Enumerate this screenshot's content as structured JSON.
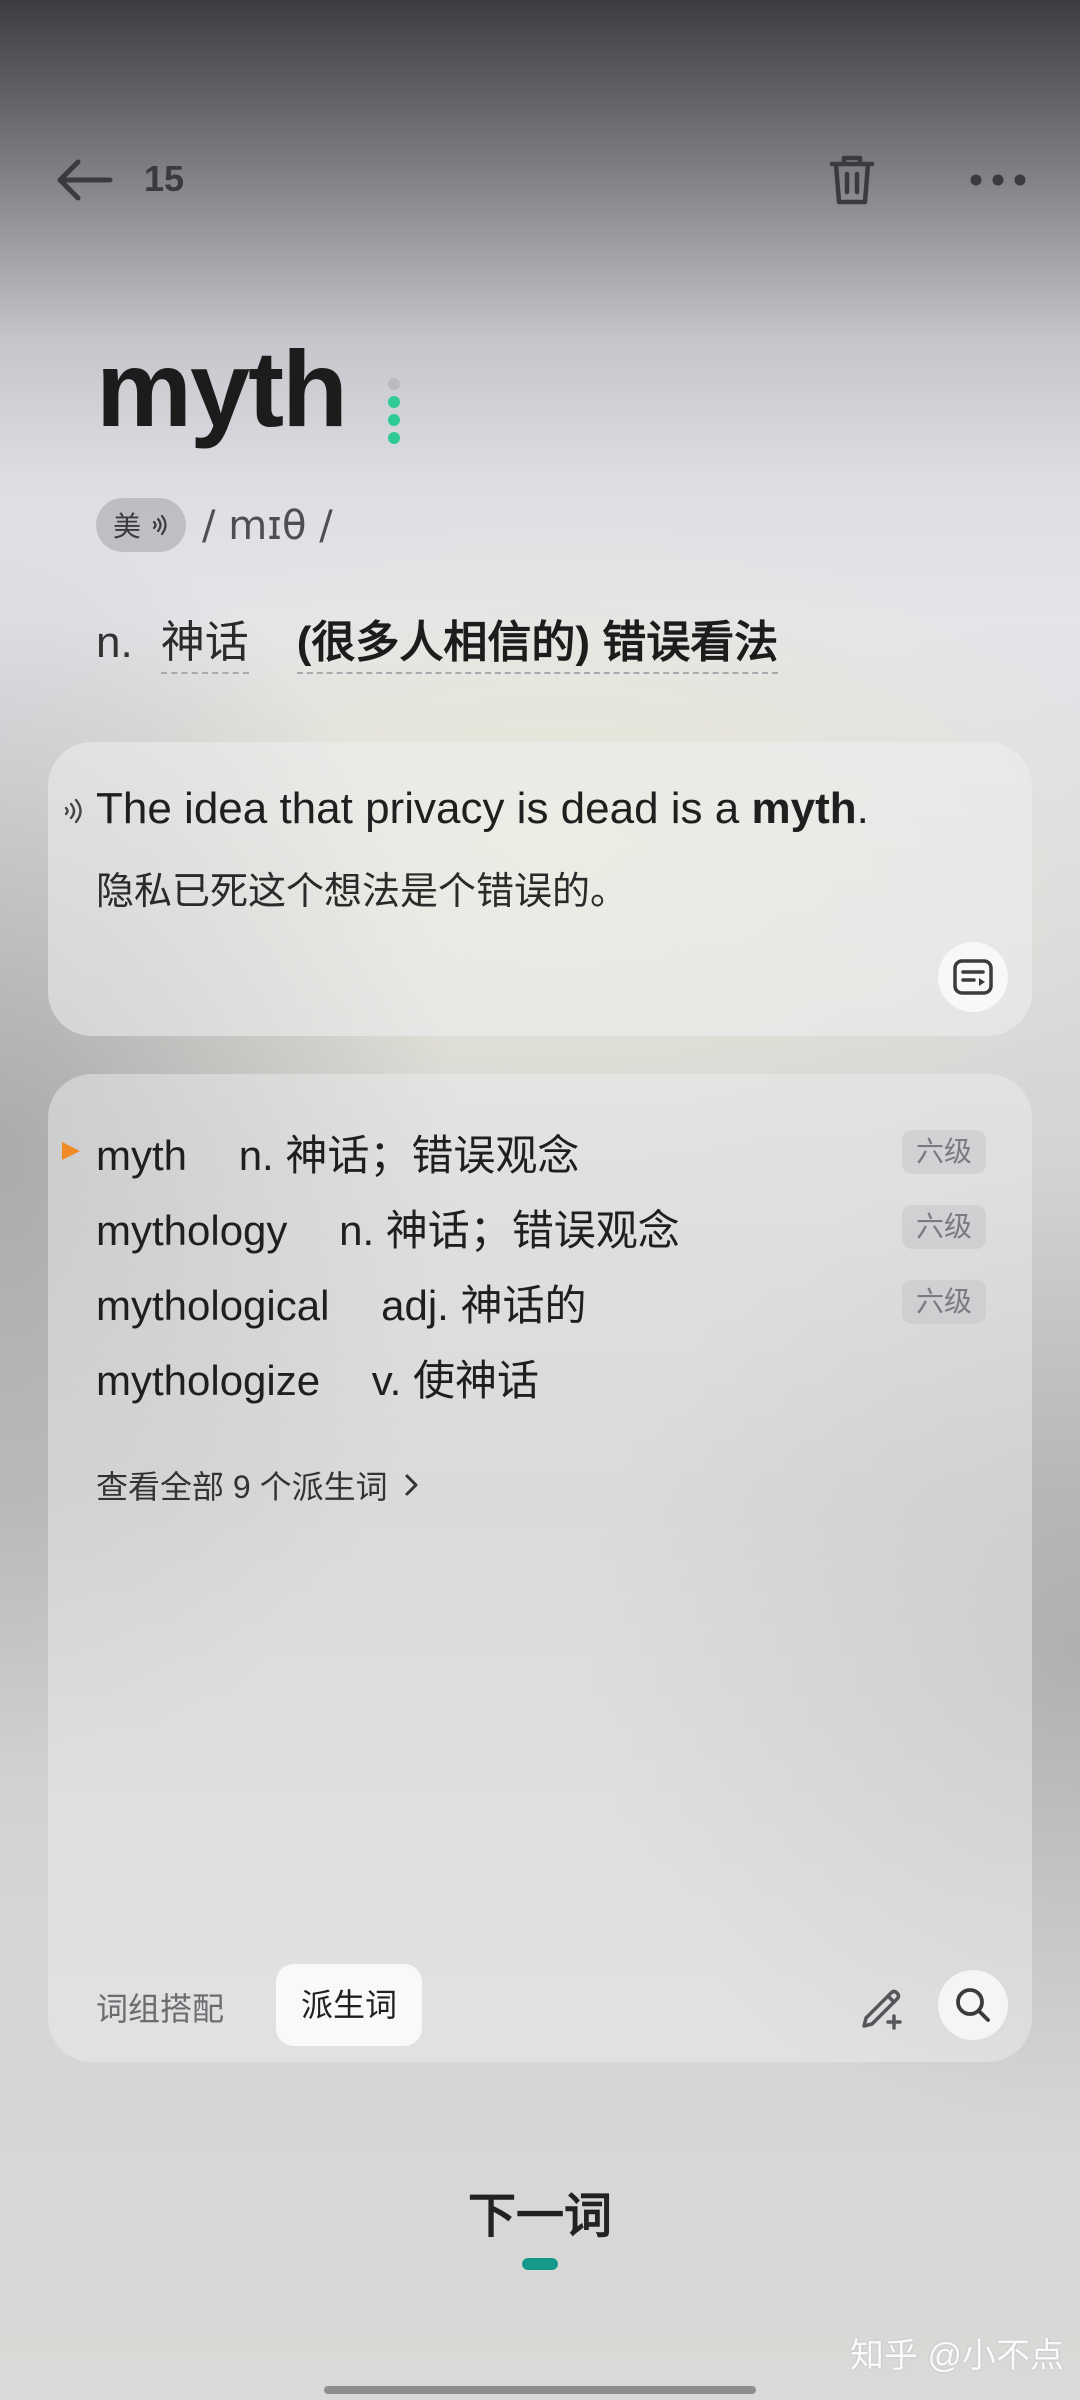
{
  "topbar": {
    "count": "15",
    "back_icon": "arrow-left-icon",
    "trash_icon": "trash-icon",
    "more_icon": "more-horizontal-icon"
  },
  "word": {
    "headword": "myth",
    "level_dot_colors": [
      "#b9bbbe",
      "#2fcb95",
      "#2fcb95",
      "#2fcb95"
    ],
    "pron_label": "美",
    "phonetic": "/ mɪθ /",
    "pos": "n.",
    "senses": [
      "神话",
      "(很多人相信的) 错误看法"
    ]
  },
  "example": {
    "en_before": "The idea that privacy is dead is a ",
    "en_highlight": "myth",
    "en_after": ".",
    "zh": "隐私已死这个想法是个错误的。"
  },
  "derivatives": {
    "items": [
      {
        "word": "myth",
        "meaning": "n. 神话；错误观念",
        "tag": "六级"
      },
      {
        "word": "mythology",
        "meaning": "n. 神话；错误观念",
        "tag": "六级"
      },
      {
        "word": "mythological",
        "meaning": "adj. 神话的",
        "tag": "六级"
      },
      {
        "word": "mythologize",
        "meaning": "v. 使神话",
        "tag": ""
      }
    ],
    "view_all": "查看全部 9 个派生词",
    "tabs": {
      "phrases": "词组搭配",
      "derivatives": "派生词"
    }
  },
  "footer": {
    "next_word": "下一词",
    "accent_color": "#17998a",
    "watermark": "知乎 @小不点"
  }
}
